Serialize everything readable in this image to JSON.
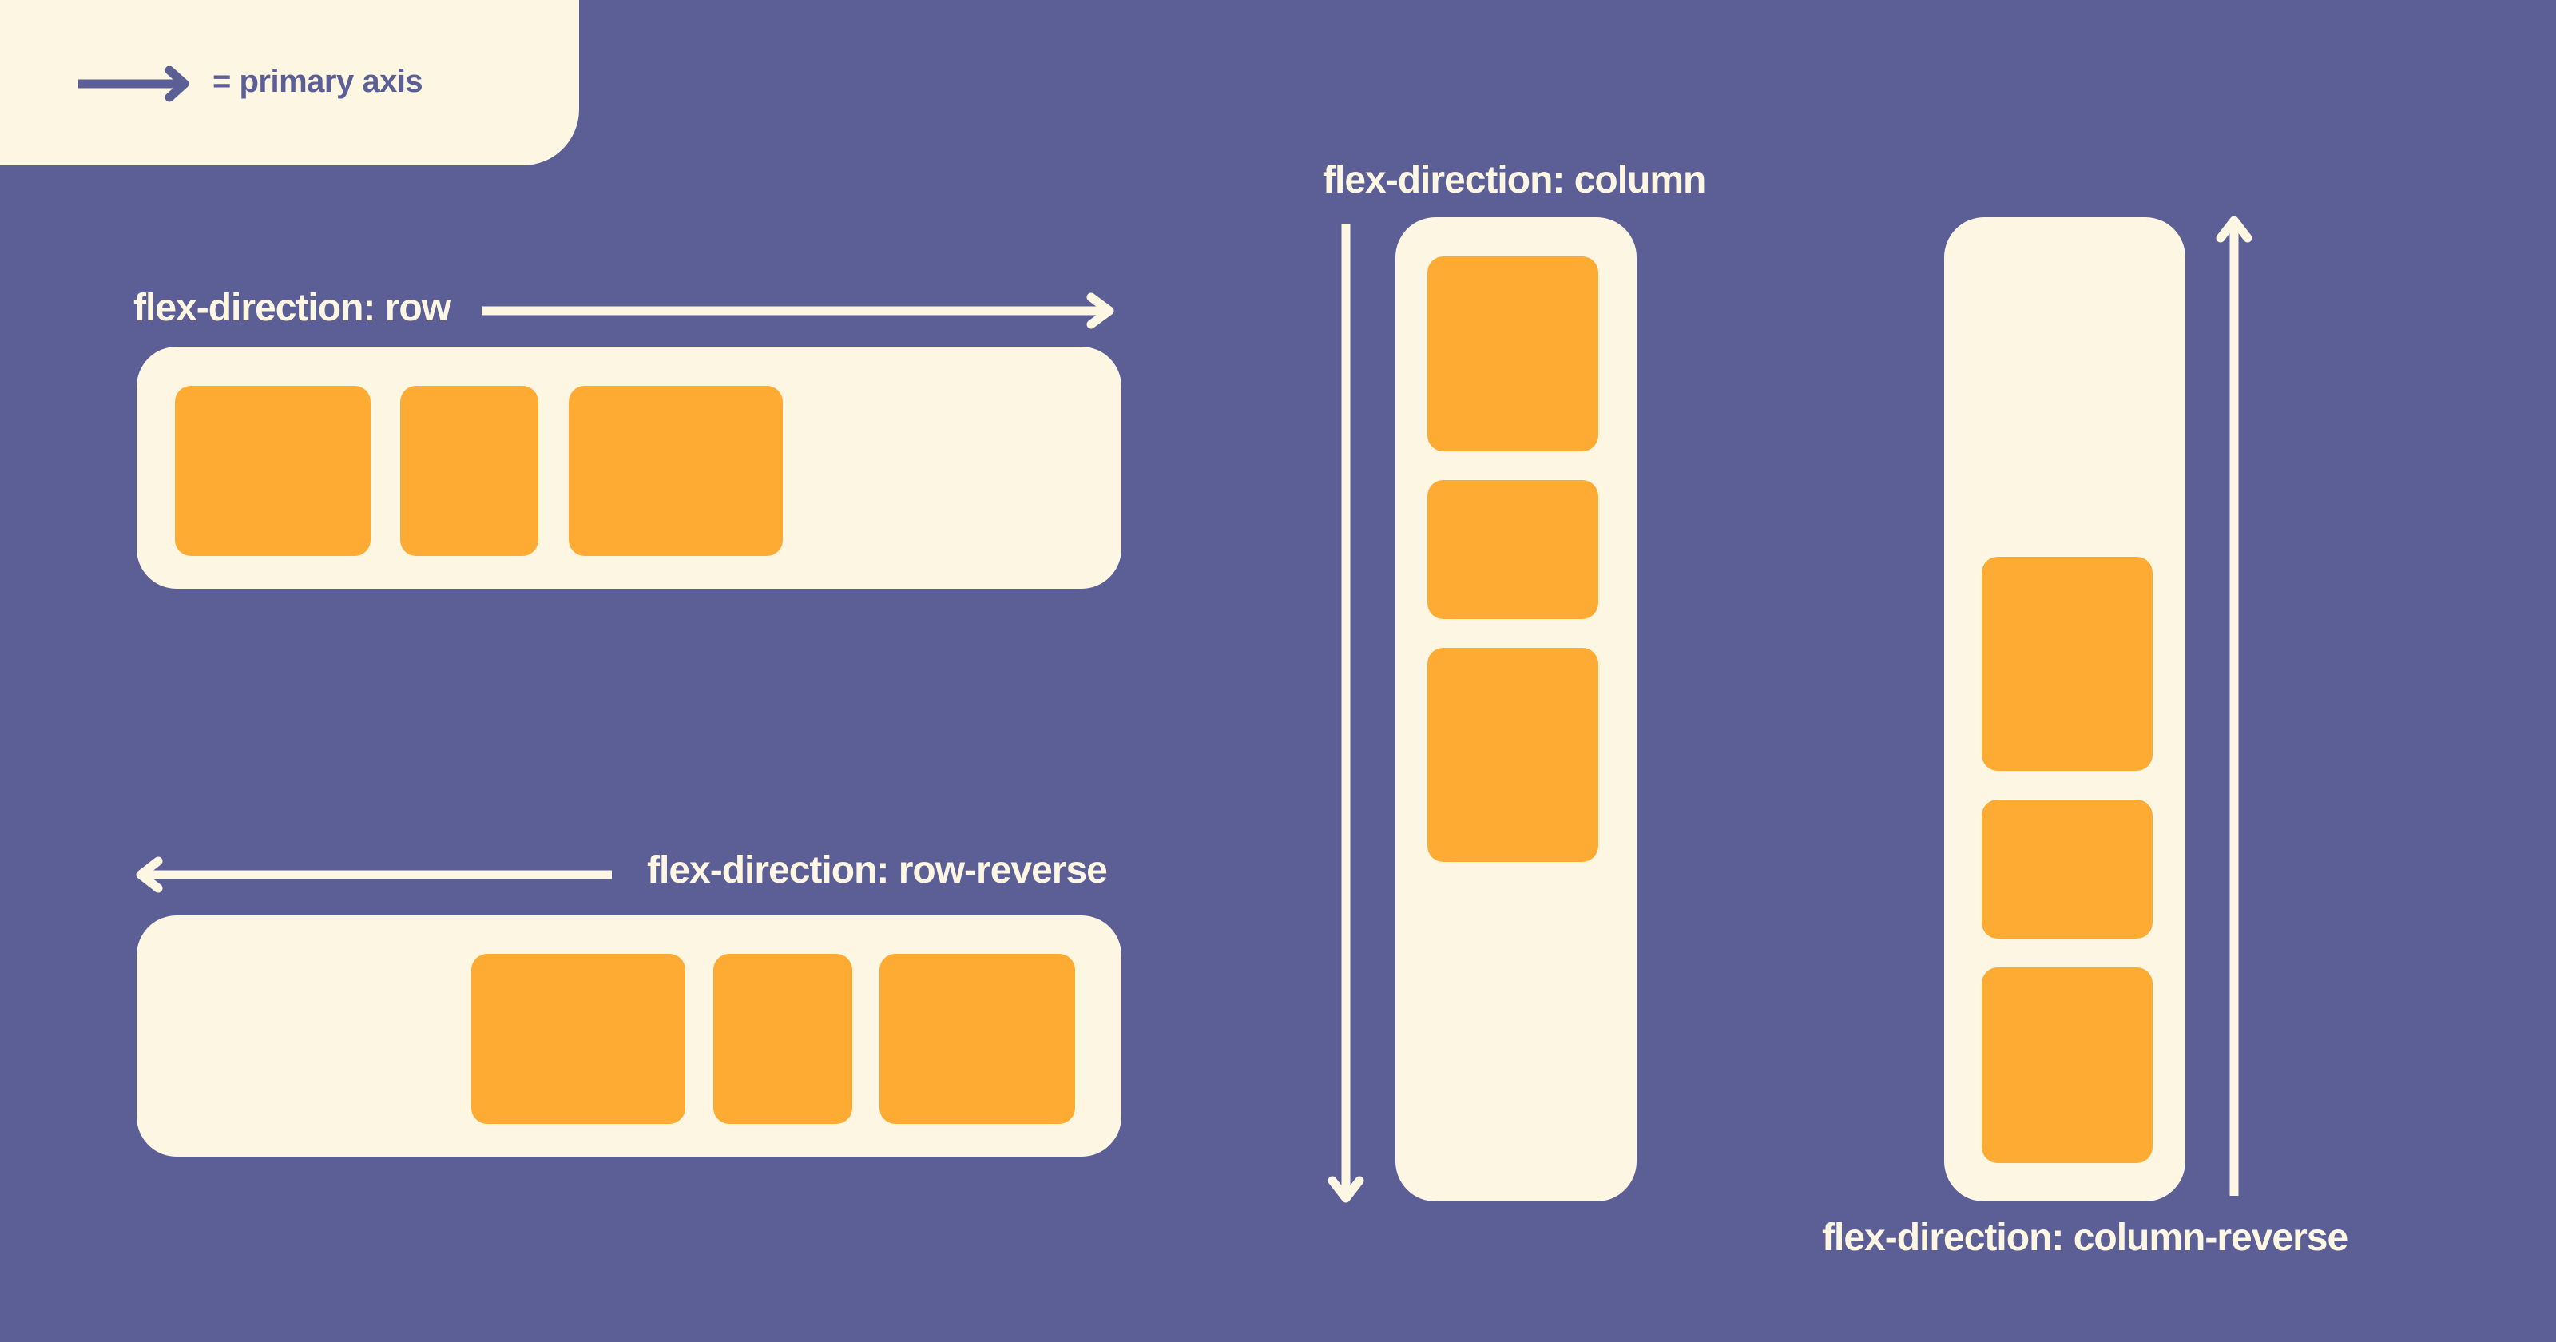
{
  "legend": {
    "icon": "arrow-right-icon",
    "label": "= primary axis"
  },
  "colors": {
    "background": "#5B5F95",
    "container": "#FDF6E3",
    "item": "#FEAB33"
  },
  "examples": [
    {
      "id": "row",
      "label": "flex-direction: row",
      "axis_icon": "arrow-right-icon",
      "item_count": 3
    },
    {
      "id": "row-reverse",
      "label": "flex-direction: row-reverse",
      "axis_icon": "arrow-left-icon",
      "item_count": 3
    },
    {
      "id": "column",
      "label": "flex-direction: column",
      "axis_icon": "arrow-down-icon",
      "item_count": 3
    },
    {
      "id": "column-reverse",
      "label": "flex-direction: column-reverse",
      "axis_icon": "arrow-up-icon",
      "item_count": 3
    }
  ]
}
